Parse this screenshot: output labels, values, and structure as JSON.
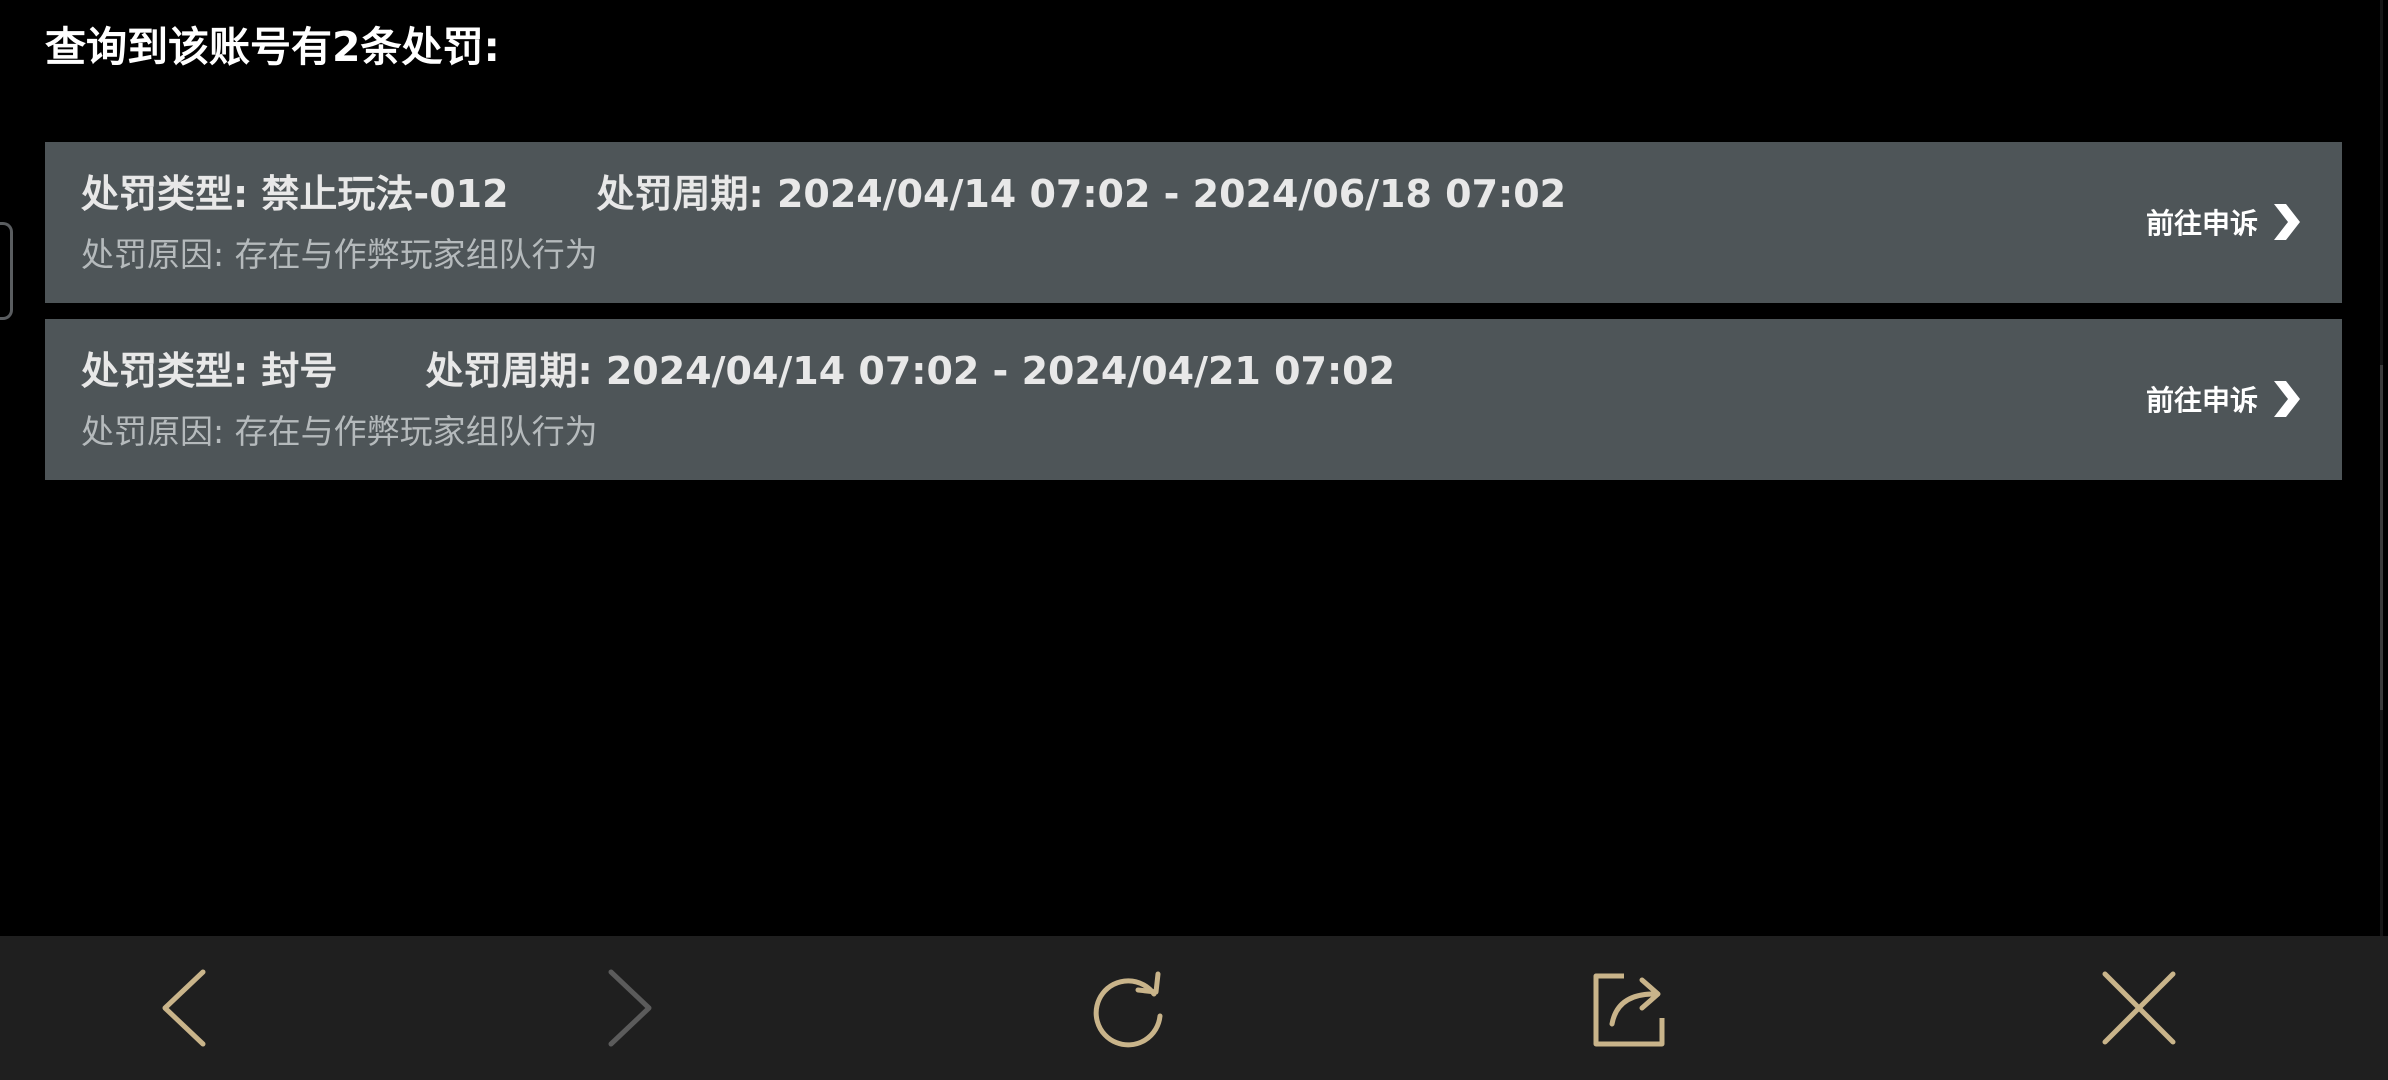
{
  "heading": "查询到该账号有2条处罚:",
  "penalties": [
    {
      "type_label": "处罚类型: 禁止玩法-012",
      "period_label": "处罚周期: 2024/04/14 07:02 - 2024/06/18 07:02",
      "reason": "处罚原因: 存在与作弊玩家组队行为",
      "appeal_label": "前往申诉"
    },
    {
      "type_label": "处罚类型: 封号",
      "period_label": "处罚周期: 2024/04/14 07:02 - 2024/04/21 07:02",
      "reason": "处罚原因: 存在与作弊玩家组队行为",
      "appeal_label": "前往申诉"
    }
  ],
  "toolbar": {
    "icons": [
      "back-arrow-icon",
      "forward-arrow-icon",
      "refresh-icon",
      "share-icon",
      "close-icon"
    ],
    "icon_color": "#c9b48a",
    "disabled_icon_color": "#5b5b5b"
  },
  "colors": {
    "background": "#000000",
    "card": "#4e5558",
    "toolbar_background": "#1f1f1f"
  }
}
